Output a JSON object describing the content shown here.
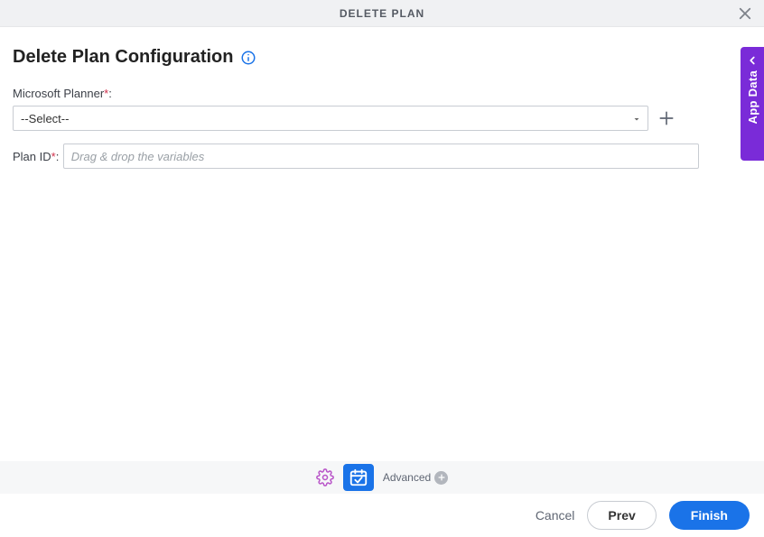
{
  "header": {
    "title": "DELETE PLAN"
  },
  "page": {
    "title": "Delete Plan Configuration"
  },
  "fields": {
    "planner": {
      "label": "Microsoft Planner",
      "required_mark": "*",
      "colon": ":",
      "selected": "--Select--"
    },
    "plan_id": {
      "label": "Plan ID",
      "required_mark": "*",
      "colon": ":",
      "placeholder": "Drag & drop the variables",
      "value": ""
    }
  },
  "sidepanel": {
    "label": "App Data"
  },
  "toolbar": {
    "advanced_label": "Advanced"
  },
  "footer": {
    "cancel": "Cancel",
    "prev": "Prev",
    "finish": "Finish"
  },
  "icons": {
    "close": "close-icon",
    "info": "info-icon",
    "dropdown": "chevron-down-icon",
    "plus": "plus-icon",
    "gear": "gear-icon",
    "calendar": "calendar-icon",
    "chevron_left": "chevron-left-icon",
    "circle_plus": "circle-plus-icon"
  },
  "colors": {
    "primary": "#1a73e8",
    "accent_purple": "#7a2bd8",
    "required": "#d0314c"
  }
}
